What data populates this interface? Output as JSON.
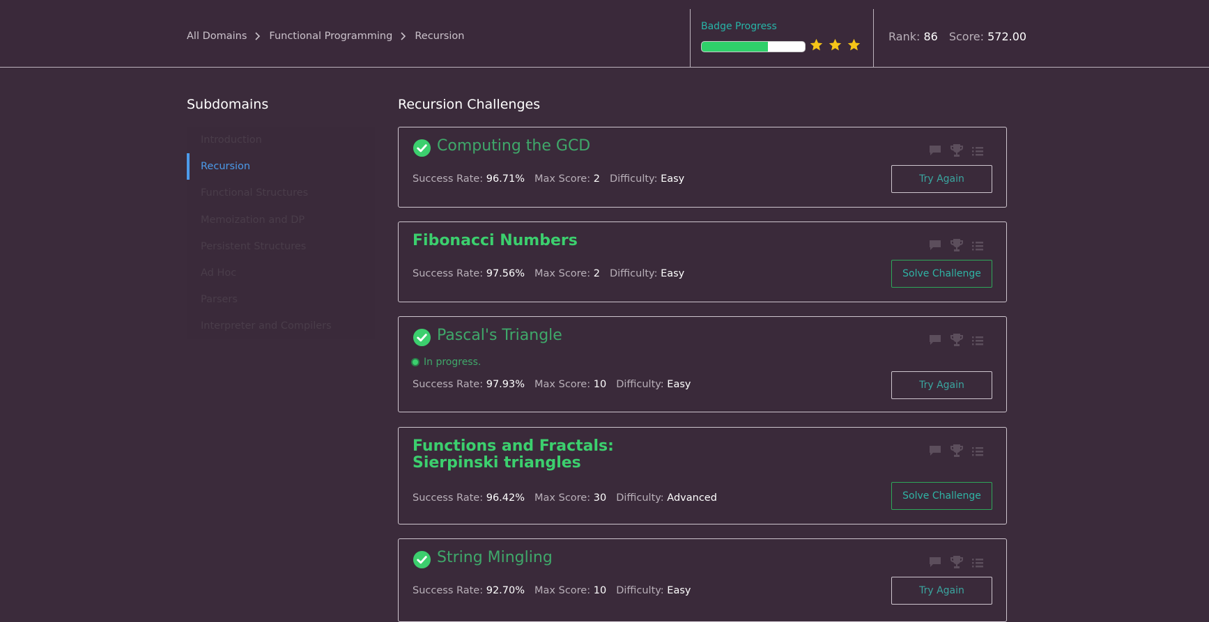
{
  "breadcrumb": {
    "items": [
      "All Domains",
      "Functional Programming",
      "Recursion"
    ]
  },
  "badge": {
    "title": "Badge Progress",
    "progress_percent": 64,
    "stars_filled": 3,
    "star_color": "#f5c518",
    "fill_color": "#2fd06a"
  },
  "stats": {
    "rank_label": "Rank:",
    "rank_value": "86",
    "score_label": "Score:",
    "score_value": "572.00"
  },
  "sidebar": {
    "title": "Subdomains",
    "items": [
      {
        "label": "Introduction",
        "active": false
      },
      {
        "label": "Recursion",
        "active": true
      },
      {
        "label": "Functional Structures",
        "active": false
      },
      {
        "label": "Memoization and DP",
        "active": false
      },
      {
        "label": "Persistent Structures",
        "active": false
      },
      {
        "label": "Ad Hoc",
        "active": false
      },
      {
        "label": "Parsers",
        "active": false
      },
      {
        "label": "Interpreter and Compilers",
        "active": false
      }
    ]
  },
  "main": {
    "title": "Recursion Challenges",
    "labels": {
      "success_rate": "Success Rate:",
      "max_score": "Max Score:",
      "difficulty": "Difficulty:"
    },
    "challenges": [
      {
        "title": "Computing the GCD",
        "solved": true,
        "in_progress": "",
        "success_rate": "96.71%",
        "max_score": "2",
        "difficulty": "Easy",
        "button": "Try Again"
      },
      {
        "title": "Fibonacci Numbers",
        "solved": false,
        "in_progress": "",
        "success_rate": "97.56%",
        "max_score": "2",
        "difficulty": "Easy",
        "button": "Solve Challenge"
      },
      {
        "title": "Pascal's Triangle",
        "solved": true,
        "in_progress": "In progress.",
        "success_rate": "97.93%",
        "max_score": "10",
        "difficulty": "Easy",
        "button": "Try Again"
      },
      {
        "title": "Functions and Fractals: Sierpinski triangles",
        "solved": false,
        "in_progress": "",
        "success_rate": "96.42%",
        "max_score": "30",
        "difficulty": "Advanced",
        "button": "Solve Challenge"
      },
      {
        "title": "String Mingling",
        "solved": true,
        "in_progress": "",
        "success_rate": "92.70%",
        "max_score": "10",
        "difficulty": "Easy",
        "button": "Try Again"
      }
    ]
  },
  "icons": {
    "check": "check-circle-icon",
    "discussion": "discussion-icon",
    "leaderboard": "trophy-icon",
    "editorial": "list-icon",
    "chevron": "chevron-right-icon",
    "star": "star-icon"
  }
}
